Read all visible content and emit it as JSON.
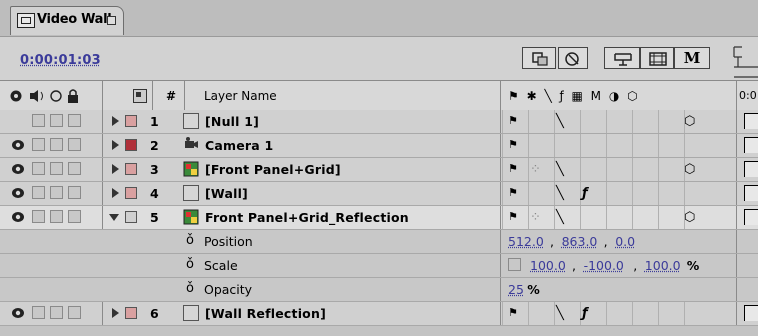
{
  "tab": {
    "title": "Video Wall"
  },
  "header": {
    "timecode": "0:00:01:03",
    "mode_label": "M"
  },
  "columns": {
    "layer_name": "Layer Name",
    "number": "#",
    "switches": "⚑ ✱ ╲ ƒ ▦ M ◑ ⬡",
    "time_tick": "0:0"
  },
  "layers": [
    {
      "num": "1",
      "name": "[Null 1]",
      "label_color": "#d9a0a0",
      "eye": false,
      "expanded": false,
      "type": "null"
    },
    {
      "num": "2",
      "name": "Camera 1",
      "label_color": "#b0303a",
      "eye": true,
      "expanded": false,
      "type": "camera"
    },
    {
      "num": "3",
      "name": "[Front Panel+Grid]",
      "label_color": "#d9a0a0",
      "eye": true,
      "expanded": false,
      "type": "comp"
    },
    {
      "num": "4",
      "name": "[Wall]",
      "label_color": "#d9a0a0",
      "eye": true,
      "expanded": false,
      "type": "solid"
    },
    {
      "num": "5",
      "name": "Front Panel+Grid_Reflection",
      "label_color": "#d0d0d0",
      "eye": true,
      "expanded": true,
      "type": "comp"
    },
    {
      "num": "6",
      "name": "[Wall Reflection]",
      "label_color": "#d9a0a0",
      "eye": true,
      "expanded": false,
      "type": "solid"
    }
  ],
  "properties": [
    {
      "name": "Position",
      "v1": "512.0",
      "sep1": ",",
      "v2": "863.0",
      "sep2": ",",
      "v3": "0.0",
      "unit": ""
    },
    {
      "name": "Scale",
      "v1": "100.0",
      "sep1": ",",
      "v2": "-100.0",
      "sep2": ",",
      "v3": "100.0",
      "unit": "%"
    },
    {
      "name": "Opacity",
      "v1": "25",
      "unit": "%"
    }
  ],
  "colors": {
    "value_link": "#3b3b9a",
    "bg": "#c3c3c3"
  }
}
